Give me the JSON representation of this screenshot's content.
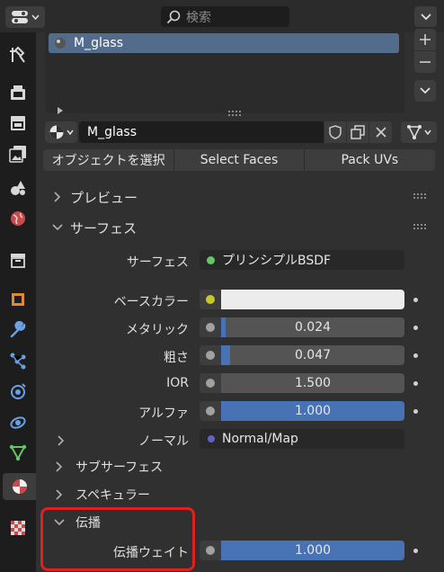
{
  "header": {
    "editor_icon": "properties-editor-icon",
    "search_placeholder": "検索"
  },
  "sidebar": {
    "tabs": [
      {
        "name": "tool-icon"
      },
      {
        "name": "render-icon"
      },
      {
        "name": "output-icon"
      },
      {
        "name": "view-layer-icon"
      },
      {
        "name": "scene-icon"
      },
      {
        "name": "world-icon"
      },
      {
        "name": "collection-icon"
      },
      {
        "name": "object-icon"
      },
      {
        "name": "modifier-icon"
      },
      {
        "name": "particles-icon"
      },
      {
        "name": "physics-icon"
      },
      {
        "name": "constraints-icon"
      },
      {
        "name": "data-icon"
      },
      {
        "name": "material-icon"
      },
      {
        "name": "texture-icon"
      }
    ],
    "active_tab": "material-icon"
  },
  "material_slots": {
    "items": [
      "M_glass"
    ]
  },
  "material_bar": {
    "name": "M_glass"
  },
  "mode_buttons": {
    "select_object": "オブジェクトを選択",
    "select_faces": "Select Faces",
    "pack_uvs": "Pack UVs"
  },
  "panels": {
    "preview": "プレビュー",
    "surface": "サーフェス"
  },
  "surface": {
    "surface_label": "サーフェス",
    "surface_value": "プリンシプルBSDF",
    "base_color_label": "ベースカラー",
    "base_color": "#ececec",
    "metallic_label": "メタリック",
    "metallic_value": "0.024",
    "metallic_fill": 0.024,
    "roughness_label": "粗さ",
    "roughness_value": "0.047",
    "roughness_fill": 0.047,
    "ior_label": "IOR",
    "ior_value": "1.500",
    "alpha_label": "アルファ",
    "alpha_value": "1.000",
    "alpha_fill": 1.0,
    "normal_label": "ノーマル",
    "normal_value": "Normal/Map",
    "subsurface_label": "サブサーフェス",
    "specular_label": "スペキュラー",
    "transmission_label": "伝播",
    "transmission_weight_label": "伝播ウェイト",
    "transmission_weight_value": "1.000",
    "transmission_weight_fill": 1.0
  },
  "colors": {
    "accent": "#4772b3",
    "selected_row": "#546c8c",
    "highlight_box": "#e01f1f",
    "socket_green": "#63c763",
    "socket_yellow": "#c7c729",
    "socket_gray": "#a1a1a1",
    "socket_purple": "#6363c7"
  }
}
